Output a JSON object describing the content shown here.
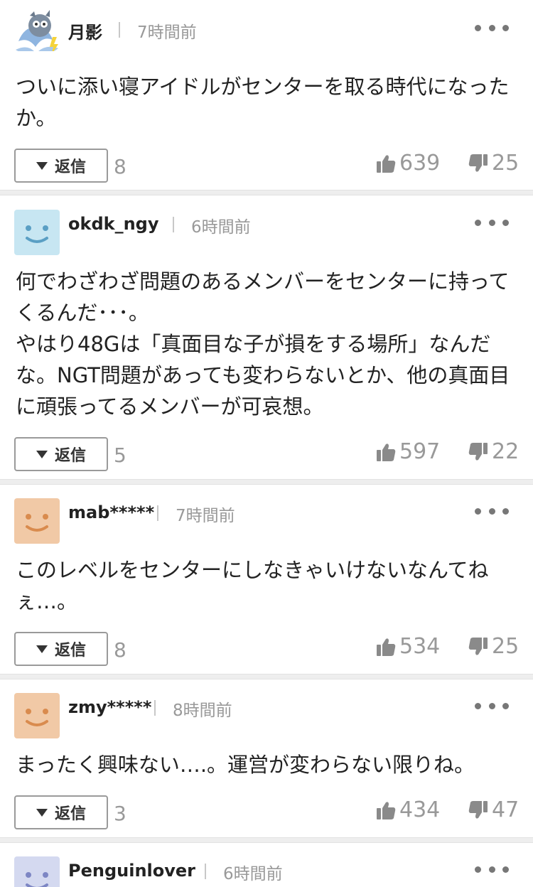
{
  "comments": [
    {
      "username": "月影",
      "time": "7時間前",
      "avatar": "mascot-avatar",
      "avatar_color": "#ffffff",
      "body": "ついに添い寝アイドルがセンターを取る時代になったか。",
      "reply_label": "返信",
      "reply_count": "8",
      "likes": "639",
      "dislikes": "25"
    },
    {
      "username": "okdk_ngy",
      "time": "6時間前",
      "avatar": "smiley-avatar",
      "avatar_color": "#c7e6f2",
      "body": "何でわざわざ問題のあるメンバーをセンターに持ってくるんだ･･･。\nやはり48Gは「真面目な子が損をする場所」なんだな。NGT問題があっても変わらないとか、他の真面目に頑張ってるメンバーが可哀想。",
      "reply_label": "返信",
      "reply_count": "5",
      "likes": "597",
      "dislikes": "22"
    },
    {
      "username": "mab*****",
      "time": "7時間前",
      "avatar": "smiley-avatar",
      "avatar_color": "#f1c9a6",
      "body": "このレベルをセンターにしなきゃいけないなんてねぇ…。",
      "reply_label": "返信",
      "reply_count": "8",
      "likes": "534",
      "dislikes": "25"
    },
    {
      "username": "zmy*****",
      "time": "8時間前",
      "avatar": "smiley-avatar",
      "avatar_color": "#f1c9a6",
      "body": "まったく興味ない….。運営が変わらない限りね。",
      "reply_label": "返信",
      "reply_count": "3",
      "likes": "434",
      "dislikes": "47"
    },
    {
      "username": "Penguinlover",
      "time": "6時間前",
      "avatar": "smiley-avatar",
      "avatar_color": "#d4d9f0"
    }
  ],
  "colors": {
    "text": "#222222",
    "muted": "#999999",
    "separator": "#eeeeee"
  }
}
